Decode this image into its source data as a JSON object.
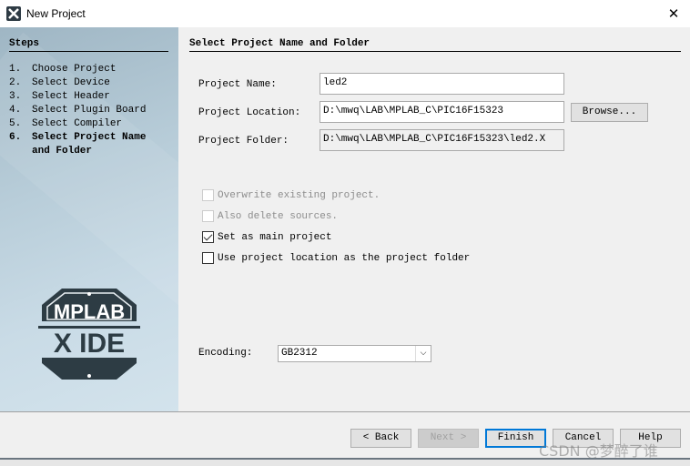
{
  "window": {
    "title": "New Project",
    "close_icon": "close-icon"
  },
  "steps": {
    "heading": "Steps",
    "items": [
      {
        "num": "1.",
        "label": "Choose Project"
      },
      {
        "num": "2.",
        "label": "Select Device"
      },
      {
        "num": "3.",
        "label": "Select Header"
      },
      {
        "num": "4.",
        "label": "Select Plugin Board"
      },
      {
        "num": "5.",
        "label": "Select Compiler"
      },
      {
        "num": "6.",
        "label": "Select Project Name",
        "label2": "and Folder",
        "current": true
      }
    ]
  },
  "logo": {
    "text1": "MPLAB",
    "text2": "X IDE"
  },
  "main": {
    "heading": "Select Project Name and Folder",
    "project_name_label": "Project Name:",
    "project_name": "led2",
    "project_location_label": "Project Location:",
    "project_location": "D:\\mwq\\LAB\\MPLAB_C\\PIC16F15323",
    "browse": "Browse...",
    "project_folder_label": "Project Folder:",
    "project_folder": "D:\\mwq\\LAB\\MPLAB_C\\PIC16F15323\\led2.X",
    "checkboxes": [
      {
        "label": "Overwrite existing project.",
        "checked": false,
        "enabled": false
      },
      {
        "label": "Also delete sources.",
        "checked": false,
        "enabled": false
      },
      {
        "label": "Set as main project",
        "checked": true,
        "enabled": true
      },
      {
        "label": "Use project location as the project folder",
        "checked": false,
        "enabled": true
      }
    ],
    "encoding_label": "Encoding:",
    "encoding": "GB2312"
  },
  "buttons": {
    "back": "< Back",
    "next": "Next >",
    "finish": "Finish",
    "cancel": "Cancel",
    "help": "Help"
  },
  "watermark": "CSDN @梦醉了谁"
}
